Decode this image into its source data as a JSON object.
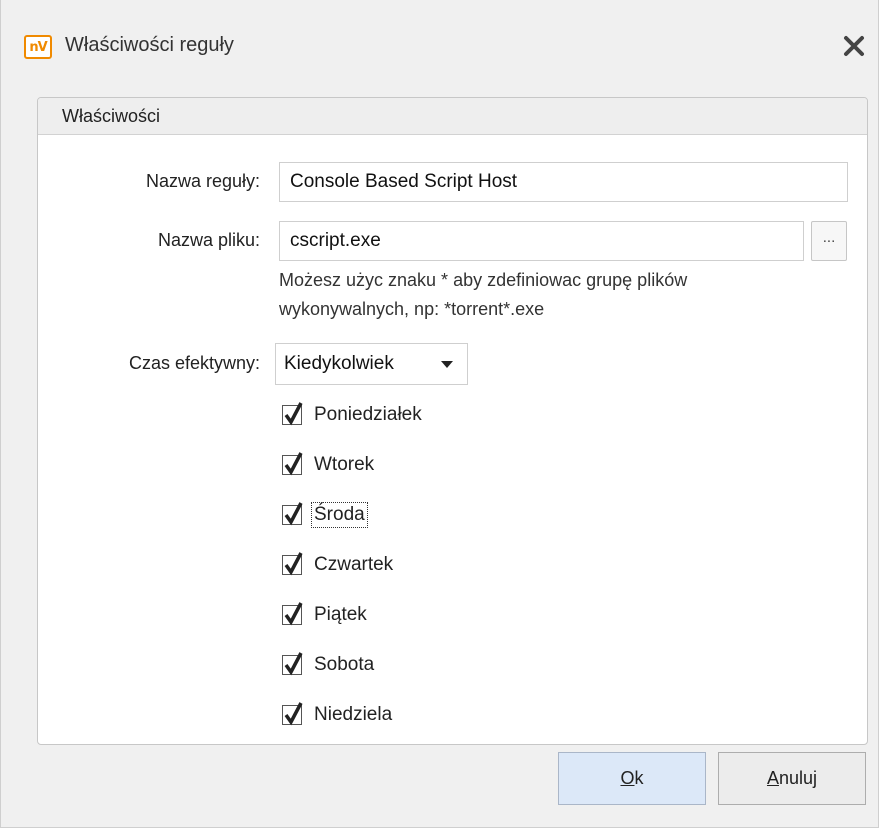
{
  "window": {
    "title": "Właściwości reguły",
    "icon_text": "nV",
    "icon_name": "nv-app-icon",
    "accent_color": "#f08a00"
  },
  "group": {
    "title": "Właściwości"
  },
  "form": {
    "rule_name": {
      "label": "Nazwa reguły:",
      "value": "Console Based Script Host"
    },
    "file_name": {
      "label": "Nazwa pliku:",
      "value": "cscript.exe",
      "browse_label": "..."
    },
    "hint": "Możesz użyc znaku * aby zdefiniowac grupę plików wykonywalnych, np: *torrent*.exe",
    "effective_time": {
      "label": "Czas efektywny:",
      "selected": "Kiedykolwiek"
    }
  },
  "days": [
    {
      "label": "Poniedziałek",
      "checked": true
    },
    {
      "label": "Wtorek",
      "checked": true
    },
    {
      "label": "Środa",
      "checked": true,
      "focused": true
    },
    {
      "label": "Czwartek",
      "checked": true
    },
    {
      "label": "Piątek",
      "checked": true
    },
    {
      "label": "Sobota",
      "checked": true
    },
    {
      "label": "Niedziela",
      "checked": true
    }
  ],
  "buttons": {
    "ok": {
      "mnemonic": "O",
      "rest": "k"
    },
    "cancel": {
      "mnemonic": "A",
      "rest": "nuluj"
    }
  }
}
